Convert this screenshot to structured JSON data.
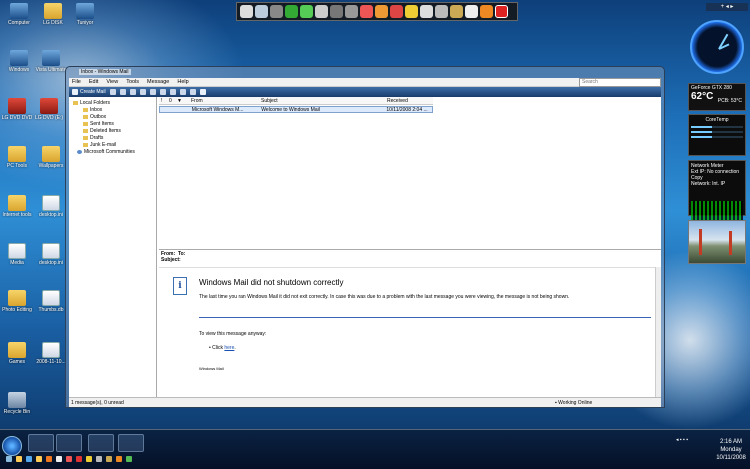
{
  "desktop": {
    "icons": [
      {
        "label": "Computer"
      },
      {
        "label": "LG DISK"
      },
      {
        "label": "Tuniyor"
      },
      {
        "label": "Windows"
      },
      {
        "label": "Vista Ultimate"
      },
      {
        "label": "LG DVD DVD"
      },
      {
        "label": "LG DVD (E:)"
      },
      {
        "label": "PC Tools"
      },
      {
        "label": "Wallpapers"
      },
      {
        "label": "Internet tools"
      },
      {
        "label": "desktop.ini"
      },
      {
        "label": "Media"
      },
      {
        "label": "desktop.ini"
      },
      {
        "label": "Photo Editing"
      },
      {
        "label": "Thumbs.db"
      },
      {
        "label": "Games"
      },
      {
        "label": "2008-11-10..."
      },
      {
        "label": "Recycle Bin"
      }
    ]
  },
  "gadgets": {
    "gpu": {
      "name": "GeForce GTX 280",
      "temp": "62°C",
      "pcb": "PCB: 53°C"
    },
    "core": {
      "title": "CoreTemp"
    },
    "net": {
      "title": "Network Meter",
      "ext_ip": "Ext IP: No connection Copy",
      "int_ip": "Network: Int. IP"
    }
  },
  "window": {
    "title": "Inbox - Windows Mail",
    "menu": [
      "File",
      "Edit",
      "View",
      "Tools",
      "Message",
      "Help"
    ],
    "search_placeholder": "Search",
    "toolbar": {
      "create_mail": "Create Mail"
    },
    "folders": [
      {
        "label": "Local Folders",
        "indent": 0,
        "type": "folder"
      },
      {
        "label": "Inbox",
        "indent": 1,
        "type": "folder"
      },
      {
        "label": "Outbox",
        "indent": 1,
        "type": "folder"
      },
      {
        "label": "Sent Items",
        "indent": 1,
        "type": "folder"
      },
      {
        "label": "Deleted Items",
        "indent": 1,
        "type": "folder"
      },
      {
        "label": "Drafts",
        "indent": 1,
        "type": "folder"
      },
      {
        "label": "Junk E-mail",
        "indent": 1,
        "type": "folder"
      },
      {
        "label": "Microsoft Communities",
        "indent": 0,
        "type": "community"
      }
    ],
    "columns": {
      "flag1": "!",
      "flag2": "0",
      "flag3": "▼",
      "from": "From",
      "subject": "Subject",
      "received": "Received"
    },
    "messages": [
      {
        "from": "Microsoft Windows M...",
        "subject": "Welcome to Windows Mail",
        "received": "10/11/2008 2:04 ..."
      }
    ],
    "preview": {
      "from_label": "From:",
      "to_label": "To:",
      "subject_label": "Subject:",
      "heading": "Windows Mail did not shutdown correctly",
      "text": "The last time you ran Windows Mail it did not exit correctly. In case this was due to a problem with the last message you were viewing, the message is not being shown.",
      "view_anyway": "To view this message anyway:",
      "click_prefix": "Click",
      "click_link": "here",
      "click_suffix": ".",
      "signature": "Windows Mail"
    },
    "status": {
      "count": "1 message(s), 0 unread",
      "online": "Working Online"
    }
  },
  "taskbar": {
    "time": "2:16 AM",
    "day": "Monday",
    "date": "10/11/2008"
  },
  "colors": {
    "accent": "#2f8fd6",
    "link": "#1a4fb3",
    "selection": "#dceafc"
  }
}
